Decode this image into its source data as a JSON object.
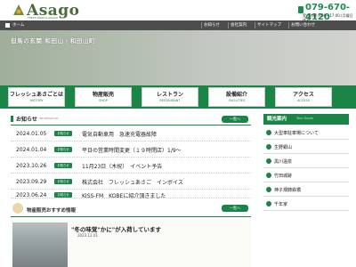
{
  "header": {
    "logo_text": "Asago",
    "logo_sub": "FRESH FARM & ASAGO",
    "phone": "079-670-4120",
    "hours": "受付時間 9:00～17:00 (月曜日休み)"
  },
  "topnav": {
    "home_label": "ホーム",
    "links": [
      "お知らせ",
      "会社案内",
      "サイトマップ",
      "お問い合わせ"
    ]
  },
  "hero": {
    "text": "但馬の玄関  和田山・和田山町"
  },
  "mainnav": {
    "items": [
      {
        "jp": "フレッシュあさごとは",
        "en": "HISTORY"
      },
      {
        "jp": "物産販売",
        "en": "SHOP"
      },
      {
        "jp": "レストラン",
        "en": "RESTAURANT"
      },
      {
        "jp": "設備紹介",
        "en": "FACILITIES"
      },
      {
        "jp": "アクセス",
        "en": "ACCESS"
      }
    ]
  },
  "news": {
    "title": "お知らせ",
    "subtitle": "INFORMATION",
    "list_button": "一覧へ",
    "badge": "お知らせ",
    "items": [
      {
        "date": "2024.01.05",
        "text": "電気自動車用　急速充電器故障"
      },
      {
        "date": "2024.01.04",
        "text": "平日の営業時間変更（１９時閉店）1/9～"
      },
      {
        "date": "2023.10.26",
        "text": "11月23日（木祝）　イベント予告"
      },
      {
        "date": "2023.09.29",
        "text": "株式会社　フレッシュあさご　インボイス"
      },
      {
        "date": "2023.06.24",
        "text": "KISS-FM　KOBEに紹介頂きました"
      }
    ]
  },
  "recommend": {
    "title": "物産販売おすすめ情報",
    "list_button": "一覧へ",
    "item_title": "\"冬の味覚\"かに\"が入荷しています",
    "item_date": "2023.12.01"
  },
  "sidebar": {
    "title": "観光案内",
    "subtitle": "Tour Guide",
    "items": [
      "大型車駐車場について",
      "生野銀山",
      "黒川温泉",
      "竹田城跡",
      "神子畑鋳鉄橋",
      "千年家"
    ]
  },
  "colors": {
    "brand_green": "#1b8447",
    "topnav_gray": "#4d4d4d"
  }
}
